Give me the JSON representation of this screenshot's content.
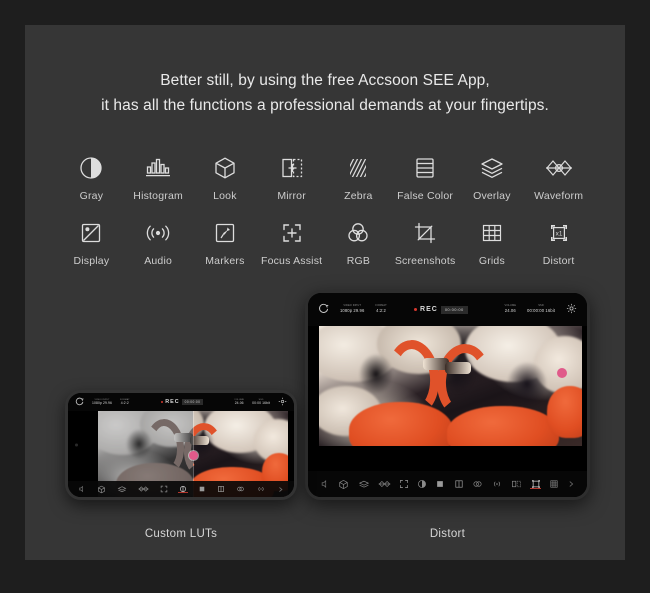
{
  "headline": {
    "line1": "Better still, by using the free Accsoon SEE App,",
    "line2": "it has all the functions a professional demands at your fingertips."
  },
  "features": {
    "row1": [
      {
        "label": "Gray",
        "icon": "gray-contrast-circle-icon"
      },
      {
        "label": "Histogram",
        "icon": "histogram-icon"
      },
      {
        "label": "Look",
        "icon": "look-cube-icon"
      },
      {
        "label": "Mirror",
        "icon": "mirror-flip-icon"
      },
      {
        "label": "Zebra",
        "icon": "zebra-stripes-icon"
      },
      {
        "label": "False Color",
        "icon": "false-color-bands-icon"
      },
      {
        "label": "Overlay",
        "icon": "overlay-layers-icon"
      },
      {
        "label": "Waveform",
        "icon": "waveform-icon"
      }
    ],
    "row2": [
      {
        "label": "Display",
        "icon": "display-brightness-icon"
      },
      {
        "label": "Audio",
        "icon": "audio-waves-icon"
      },
      {
        "label": "Markers",
        "icon": "markers-pin-icon"
      },
      {
        "label": "Focus Assist",
        "icon": "focus-assist-icon"
      },
      {
        "label": "RGB",
        "icon": "rgb-circles-icon"
      },
      {
        "label": "Screenshots",
        "icon": "screenshots-crop-icon"
      },
      {
        "label": "Grids",
        "icon": "grids-icon"
      },
      {
        "label": "Distort",
        "icon": "distort-icon"
      }
    ]
  },
  "phone": {
    "caption": "Custom LUTs",
    "topbar": {
      "back_icon": "back-arrow-icon",
      "video_input_caption": "VIDEO INPUT",
      "video_input_value": "1080p 29.96",
      "format_caption": "FORMAT",
      "format_value": "4:2:2",
      "rec_label": "REC",
      "rec_timecode": "00:00:00",
      "volume_caption": "VOLUME",
      "volume_value": "24.06",
      "battery_caption": "SSD",
      "battery_value": "00:00 16bit",
      "settings_icon": "settings-icon"
    },
    "toolbar": [
      {
        "icon": "speaker-icon",
        "active": false
      },
      {
        "icon": "look-cube-icon",
        "active": false
      },
      {
        "icon": "layers-icon",
        "active": false
      },
      {
        "icon": "waveform-icon",
        "active": false
      },
      {
        "icon": "focus-assist-icon",
        "active": false
      },
      {
        "icon": "custom-lut-icon",
        "active": true
      },
      {
        "icon": "false-color-icon",
        "active": false
      },
      {
        "icon": "overlay-icon",
        "active": false
      },
      {
        "icon": "rgb-icon",
        "active": false
      },
      {
        "icon": "audio-icon",
        "active": false
      },
      {
        "icon": "more-icon",
        "active": false
      }
    ]
  },
  "tablet": {
    "caption": "Distort",
    "topbar": {
      "back_icon": "back-arrow-icon",
      "video_input_caption": "VIDEO INPUT",
      "video_input_value": "1080p 29.96",
      "format_caption": "FORMAT",
      "format_value": "4:2:2",
      "rec_label": "REC",
      "rec_timecode": "00:00:00",
      "volume_caption": "VOLUME",
      "volume_value": "24.06",
      "battery_caption": "SSD",
      "battery_value": "00:00:00 16bit",
      "settings_icon": "settings-icon"
    },
    "toolbar": [
      {
        "icon": "speaker-icon",
        "active": false
      },
      {
        "icon": "look-cube-icon",
        "active": false
      },
      {
        "icon": "layers-icon",
        "active": false
      },
      {
        "icon": "waveform-icon",
        "active": false
      },
      {
        "icon": "focus-assist-icon",
        "active": false
      },
      {
        "icon": "gray-icon",
        "active": false
      },
      {
        "icon": "false-color-icon",
        "active": false
      },
      {
        "icon": "overlay-icon",
        "active": false
      },
      {
        "icon": "rgb-icon",
        "active": false
      },
      {
        "icon": "audio-icon",
        "active": false
      },
      {
        "icon": "mirror-icon",
        "active": false
      },
      {
        "icon": "distort-icon",
        "active": true
      },
      {
        "icon": "grids-icon",
        "active": false
      },
      {
        "icon": "more-icon",
        "active": false
      }
    ]
  },
  "colors": {
    "page_background": "#1e1e1e",
    "panel_background": "#363636",
    "text_primary": "#e9e9e9",
    "text_secondary": "#cdcdcd",
    "rec_red": "#d8382e",
    "active_red": "#b3362c",
    "flamingo_orange": "#e0522a"
  }
}
